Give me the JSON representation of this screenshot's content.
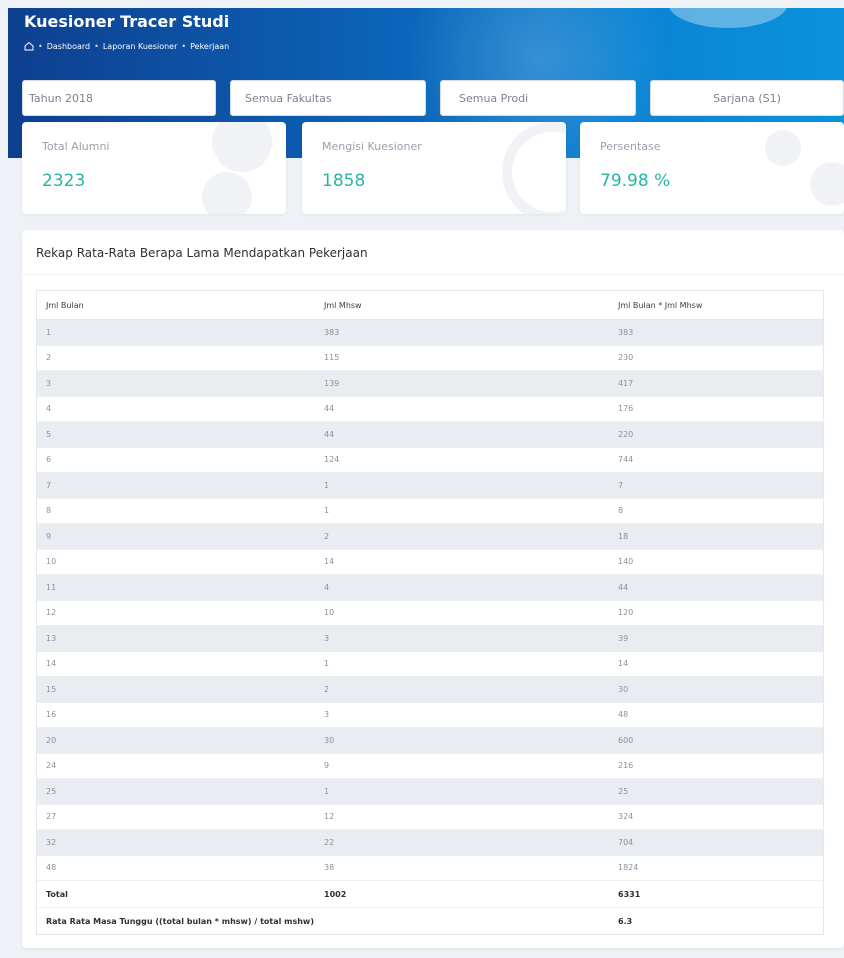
{
  "header": {
    "title": "Kuesioner Tracer Studi",
    "breadcrumbs": [
      "Dashboard",
      "Laporan Kuesioner",
      "Pekerjaan"
    ]
  },
  "filters": {
    "tahun": "Tahun 2018",
    "fakultas": "Semua Fakultas",
    "prodi": "Semua Prodi",
    "jenjang": "Sarjana (S1)"
  },
  "stats": [
    {
      "label": "Total Alumni",
      "value": "2323"
    },
    {
      "label": "Mengisi Kuesioner",
      "value": "1858"
    },
    {
      "label": "Persentase",
      "value": "79.98 %"
    }
  ],
  "panel": {
    "title": "Rekap Rata-Rata Berapa Lama Mendapatkan Pekerjaan",
    "columns": [
      "Jml Bulan",
      "Jml Mhsw",
      "Jml Bulan * Jml Mhsw"
    ],
    "rows": [
      [
        "1",
        "383",
        "383"
      ],
      [
        "2",
        "115",
        "230"
      ],
      [
        "3",
        "139",
        "417"
      ],
      [
        "4",
        "44",
        "176"
      ],
      [
        "5",
        "44",
        "220"
      ],
      [
        "6",
        "124",
        "744"
      ],
      [
        "7",
        "1",
        "7"
      ],
      [
        "8",
        "1",
        "8"
      ],
      [
        "9",
        "2",
        "18"
      ],
      [
        "10",
        "14",
        "140"
      ],
      [
        "11",
        "4",
        "44"
      ],
      [
        "12",
        "10",
        "120"
      ],
      [
        "13",
        "3",
        "39"
      ],
      [
        "14",
        "1",
        "14"
      ],
      [
        "15",
        "2",
        "30"
      ],
      [
        "16",
        "3",
        "48"
      ],
      [
        "20",
        "30",
        "600"
      ],
      [
        "24",
        "9",
        "216"
      ],
      [
        "25",
        "1",
        "25"
      ],
      [
        "27",
        "12",
        "324"
      ],
      [
        "32",
        "22",
        "704"
      ],
      [
        "48",
        "38",
        "1824"
      ]
    ],
    "total": {
      "label": "Total",
      "mhsw": "1002",
      "product": "6331"
    },
    "average": {
      "label": "Rata Rata Masa Tunggu ((total bulan * mhsw) / total mshw)",
      "value": "6.3"
    }
  },
  "colors": {
    "accent": "#26b5a6",
    "header": "#0c63b8"
  }
}
